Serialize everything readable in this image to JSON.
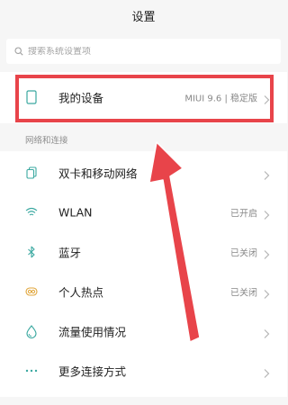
{
  "header": {
    "title": "设置"
  },
  "search": {
    "placeholder": "搜索系统设置项",
    "icon": "search-icon"
  },
  "device": {
    "label": "我的设备",
    "value": "MIUI 9.6 | 稳定版",
    "icon": "phone-icon"
  },
  "section": {
    "title": "网络和连接"
  },
  "items": [
    {
      "label": "双卡和移动网络",
      "value": "",
      "icon": "sim-card-icon"
    },
    {
      "label": "WLAN",
      "value": "已开启",
      "icon": "wifi-icon"
    },
    {
      "label": "蓝牙",
      "value": "已关闭",
      "icon": "bluetooth-icon"
    },
    {
      "label": "个人热点",
      "value": "已关闭",
      "icon": "hotspot-icon"
    },
    {
      "label": "流量使用情况",
      "value": "",
      "icon": "data-usage-icon"
    },
    {
      "label": "更多连接方式",
      "value": "",
      "icon": "more-dots-icon"
    }
  ],
  "colors": {
    "highlight": "#e8444a",
    "icon_teal": "#3aa8a0",
    "background": "#f6f6f6"
  }
}
